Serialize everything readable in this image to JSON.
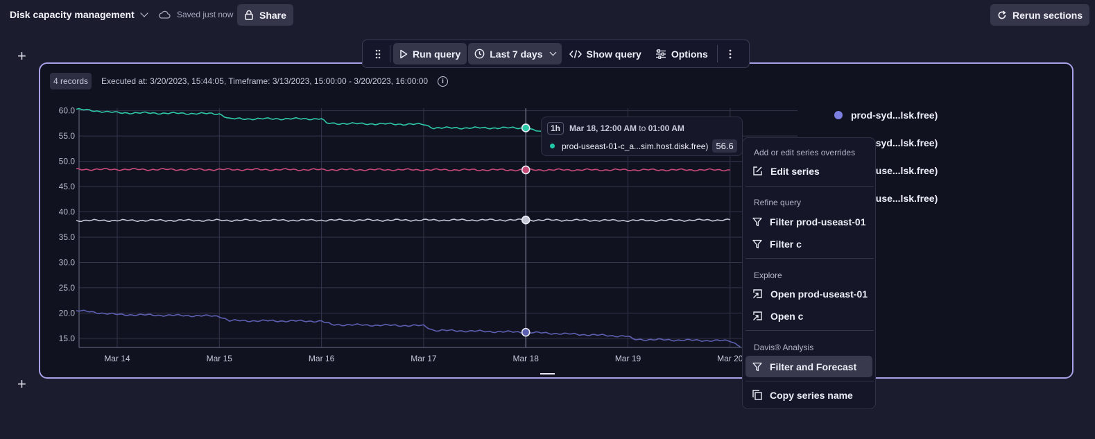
{
  "header": {
    "title": "Disk capacity management",
    "saved_status": "Saved just now",
    "share_label": "Share",
    "rerun_label": "Rerun sections"
  },
  "toolbar": {
    "run_query": "Run query",
    "timeframe": "Last 7 days",
    "show_query": "Show query",
    "options": "Options"
  },
  "card": {
    "records_badge": "4 records",
    "executed_text": "Executed at: 3/20/2023, 15:44:05, Timeframe: 3/13/2023, 15:00:00 - 3/20/2023, 16:00:00"
  },
  "legend": [
    {
      "label": "prod-syd...lsk.free)",
      "color": "#7d7fe0"
    },
    {
      "label": "prod-syd...lsk.free)",
      "color": "#eceef8"
    },
    {
      "label": "prod-use...lsk.free)",
      "color": "#e05c8c"
    },
    {
      "label": "prod-use...lsk.free)",
      "color": "#2ec9a8"
    }
  ],
  "tooltip": {
    "interval": "1h",
    "date": "Mar 18, 12:00 AM",
    "to_word": "to",
    "end_time": "01:00 AM",
    "series": "prod-useast-01-c_a...sim.host.disk.free)",
    "value": "56.6"
  },
  "menu": {
    "section_overrides": "Add or edit series overrides",
    "edit_series": "Edit series",
    "section_refine": "Refine query",
    "filter_host": "Filter prod-useast-01",
    "filter_c": "Filter c",
    "section_explore": "Explore",
    "open_host": "Open prod-useast-01",
    "open_c": "Open c",
    "section_davis": "Davis® Analysis",
    "filter_forecast": "Filter and Forecast",
    "copy_name": "Copy series name"
  },
  "chart_data": {
    "type": "line",
    "x_categories": [
      "Mar 14",
      "Mar 15",
      "Mar 16",
      "Mar 17",
      "Mar 18",
      "Mar 19",
      "Mar 20"
    ],
    "y_ticks": [
      "60.0",
      "55.0",
      "50.0",
      "45.0",
      "40.0",
      "35.0",
      "30.0",
      "25.0",
      "20.0",
      "15.0"
    ],
    "ylim": [
      13.2,
      60.5
    ],
    "grid": true,
    "series": [
      {
        "color": "#2ec9a8",
        "x": [
          -0.4,
          0.0,
          1.0,
          1.1,
          2.0,
          2.05,
          3.0,
          3.1,
          4.0,
          4.3
        ],
        "values": [
          60.3,
          59.6,
          59.4,
          58.4,
          58.4,
          57.5,
          57.3,
          56.6,
          56.6,
          54.9
        ]
      },
      {
        "color": "#c64a78",
        "x": [
          -0.4,
          4.0,
          5.0,
          6.0
        ],
        "values": [
          48.4,
          48.3,
          48.3,
          48.3
        ]
      },
      {
        "color": "#c4c6d6",
        "x": [
          -0.4,
          4.0,
          5.0,
          6.0
        ],
        "values": [
          38.3,
          38.4,
          38.3,
          38.4
        ]
      },
      {
        "color": "#5c5fb0",
        "x": [
          -0.4,
          0.0,
          1.0,
          1.1,
          2.0,
          2.1,
          3.0,
          3.1,
          4.0,
          5.0,
          5.05,
          6.0,
          6.1
        ],
        "values": [
          20.5,
          19.7,
          19.4,
          18.5,
          18.4,
          17.7,
          17.5,
          16.6,
          16.2,
          15.4,
          14.8,
          14.5,
          13.5
        ]
      }
    ],
    "highlight_x": 4.0
  }
}
